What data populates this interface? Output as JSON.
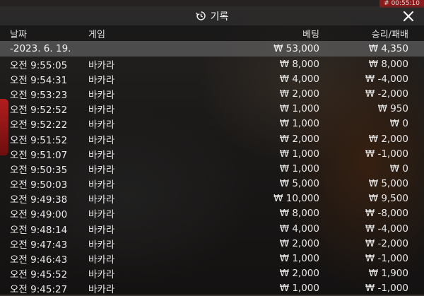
{
  "timer": "# 00:55:10",
  "dialog": {
    "title": "기록",
    "icon": "history-icon",
    "close_icon": "close-icon"
  },
  "columns": {
    "date": "날짜",
    "game": "게임",
    "bet": "베팅",
    "result": "승리/패배"
  },
  "summary": {
    "date": "-2023. 6. 19.",
    "bet": "₩ 53,000",
    "result": "₩ 4,350"
  },
  "rows": [
    {
      "time": "오전 9:55:05",
      "game": "바카라",
      "bet": "₩ 8,000",
      "result": "₩ 8,000"
    },
    {
      "time": "오전 9:54:31",
      "game": "바카라",
      "bet": "₩ 4,000",
      "result": "₩ -4,000"
    },
    {
      "time": "오전 9:53:23",
      "game": "바카라",
      "bet": "₩ 2,000",
      "result": "₩ -2,000"
    },
    {
      "time": "오전 9:52:52",
      "game": "바카라",
      "bet": "₩ 1,000",
      "result": "₩ 950"
    },
    {
      "time": "오전 9:52:22",
      "game": "바카라",
      "bet": "₩ 1,000",
      "result": "₩ 0"
    },
    {
      "time": "오전 9:51:52",
      "game": "바카라",
      "bet": "₩ 2,000",
      "result": "₩ 2,000"
    },
    {
      "time": "오전 9:51:07",
      "game": "바카라",
      "bet": "₩ 1,000",
      "result": "₩ -1,000"
    },
    {
      "time": "오전 9:50:35",
      "game": "바카라",
      "bet": "₩ 1,000",
      "result": "₩ 0"
    },
    {
      "time": "오전 9:50:03",
      "game": "바카라",
      "bet": "₩ 5,000",
      "result": "₩ 5,000"
    },
    {
      "time": "오전 9:49:38",
      "game": "바카라",
      "bet": "₩ 10,000",
      "result": "₩ 9,500"
    },
    {
      "time": "오전 9:49:00",
      "game": "바카라",
      "bet": "₩ 8,000",
      "result": "₩ -8,000"
    },
    {
      "time": "오전 9:48:14",
      "game": "바카라",
      "bet": "₩ 4,000",
      "result": "₩ -4,000"
    },
    {
      "time": "오전 9:47:43",
      "game": "바카라",
      "bet": "₩ 2,000",
      "result": "₩ -2,000"
    },
    {
      "time": "오전 9:46:43",
      "game": "바카라",
      "bet": "₩ 1,000",
      "result": "₩ -1,000"
    },
    {
      "time": "오전 9:45:52",
      "game": "바카라",
      "bet": "₩ 2,000",
      "result": "₩ 1,900"
    },
    {
      "time": "오전 9:45:27",
      "game": "바카라",
      "bet": "₩ 1,000",
      "result": "₩ -1,000"
    }
  ]
}
